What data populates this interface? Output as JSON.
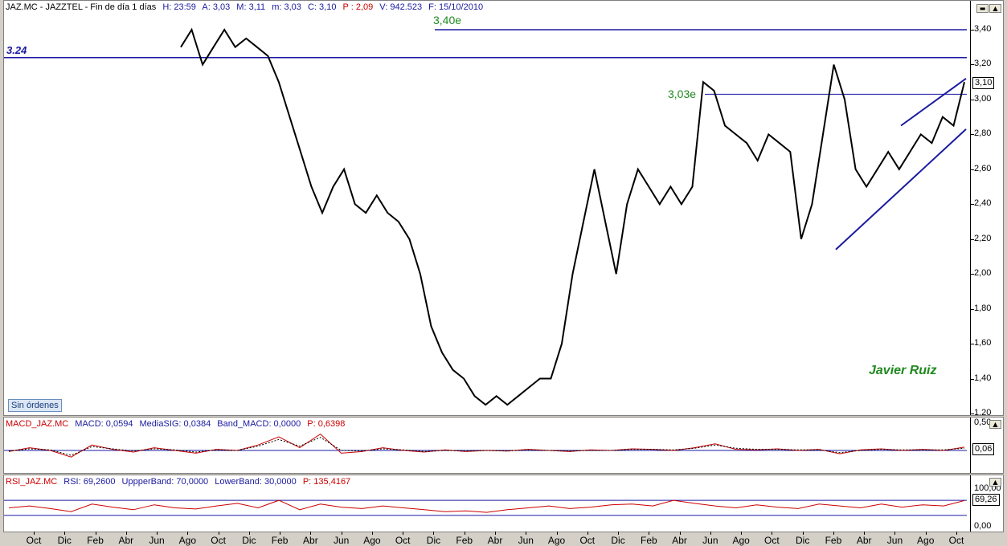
{
  "price_pane": {
    "header": {
      "symbol": "JAZ.MC - JAZZTEL - Fin de día 1 días",
      "h": "H: 23:59",
      "a": "A: 3,03",
      "m_hi": "M: 3,11",
      "m_lo": "m: 3,03",
      "c": "C: 3,10",
      "p": "P : 2,09",
      "v": "V: 942.523",
      "f": "F: 15/10/2010"
    },
    "sin_ordenes": "Sin órdenes",
    "author": "Javier Ruiz",
    "annotations": {
      "top_line": "3,40e",
      "mid_line": "3,03e",
      "left_line": "3.24"
    },
    "last_value": "3,10"
  },
  "macd_pane": {
    "header": {
      "name": "MACD_JAZ.MC",
      "macd": "MACD: 0,0594",
      "signal": "MediaSIG: 0,0384",
      "band": "Band_MACD: 0,0000",
      "p": "P: 0,6398"
    },
    "last_value": "0,06"
  },
  "rsi_pane": {
    "header": {
      "name": "RSI_JAZ.MC",
      "rsi": "RSI: 69,2600",
      "upper": "UppperBand: 70,0000",
      "lower": "LowerBand: 30,0000",
      "p": "P: 135,4167"
    },
    "last_value": "69,26"
  },
  "colors": {
    "price": "#000000",
    "trendline": "#1a1aa0",
    "macd": "#cc0000",
    "signal": "#000000",
    "rsi": "#cc0000",
    "header_blue": "#1a1aa0",
    "header_red": "#cc0000",
    "label_green": "#1f8a1f"
  },
  "chart_data": [
    {
      "type": "line",
      "title": "",
      "xlabel": "",
      "ylabel": "",
      "ylim": [
        1.2,
        3.45
      ],
      "y_ticks": [
        "3,40",
        "3,20",
        "3,00",
        "2,80",
        "2,60",
        "2,40",
        "2,20",
        "2,00",
        "1,80",
        "1,60",
        "1,40",
        "1,20"
      ],
      "x_ticks": [
        "Oct",
        "Dic",
        "Feb",
        "Abr",
        "Jun",
        "Ago",
        "Oct",
        "Dic",
        "Feb",
        "Abr",
        "Jun",
        "Ago",
        "Oct",
        "Dic",
        "Feb",
        "Abr",
        "Jun",
        "Ago",
        "Oct",
        "Dic",
        "Feb",
        "Abr",
        "Jun",
        "Ago",
        "Oct",
        "Dic",
        "Feb",
        "Abr",
        "Jun",
        "Ago",
        "Oct"
      ],
      "series": [
        {
          "values": [
            3.3,
            3.4,
            3.2,
            3.3,
            3.4,
            3.3,
            3.35,
            3.3,
            3.25,
            3.1,
            2.9,
            2.7,
            2.5,
            2.35,
            2.5,
            2.6,
            2.4,
            2.35,
            2.45,
            2.35,
            2.3,
            2.2,
            2.0,
            1.7,
            1.55,
            1.45,
            1.4,
            1.3,
            1.25,
            1.3,
            1.25,
            1.3,
            1.35,
            1.4,
            1.4,
            1.6,
            2.0,
            2.3,
            2.6,
            2.3,
            2.0,
            2.4,
            2.6,
            2.5,
            2.4,
            2.5,
            2.4,
            2.5,
            3.1,
            3.05,
            2.85,
            2.8,
            2.75,
            2.65,
            2.8,
            2.75,
            2.7,
            2.2,
            2.4,
            2.8,
            3.2,
            3.0,
            2.6,
            2.5,
            2.6,
            2.7,
            2.6,
            2.7,
            2.8,
            2.75,
            2.9,
            2.85,
            3.1
          ]
        }
      ],
      "hlines": [
        3.4,
        3.24,
        3.03
      ],
      "grid": false
    },
    {
      "type": "line",
      "title": "",
      "y_ticks": [
        "0,50",
        "0,00"
      ],
      "series": [
        {
          "name": "MACD",
          "values": [
            -0.02,
            0.05,
            0.0,
            -0.12,
            0.1,
            0.02,
            -0.03,
            0.05,
            0.0,
            -0.05,
            0.02,
            0.0,
            0.1,
            0.25,
            0.05,
            0.3,
            -0.05,
            -0.02,
            0.05,
            0.0,
            -0.03,
            0.01,
            -0.02,
            0.0,
            -0.01,
            0.02,
            0.0,
            -0.02,
            0.01,
            0.0,
            0.03,
            0.02,
            0.0,
            0.05,
            0.12,
            0.02,
            0.01,
            0.03,
            0.0,
            0.02,
            -0.06,
            0.01,
            0.03,
            0.0,
            0.02,
            0.0,
            0.06
          ]
        },
        {
          "name": "MediaSIG",
          "values": [
            -0.01,
            0.03,
            0.01,
            -0.09,
            0.07,
            0.03,
            -0.01,
            0.03,
            0.01,
            -0.03,
            0.01,
            0.0,
            0.08,
            0.2,
            0.08,
            0.24,
            0.0,
            -0.01,
            0.03,
            0.01,
            -0.02,
            0.0,
            -0.01,
            0.0,
            -0.01,
            0.01,
            0.0,
            -0.01,
            0.0,
            0.0,
            0.02,
            0.02,
            0.01,
            0.04,
            0.1,
            0.04,
            0.02,
            0.02,
            0.01,
            0.01,
            -0.04,
            0.0,
            0.02,
            0.01,
            0.01,
            0.01,
            0.04
          ]
        }
      ],
      "hlines": [
        0.0
      ]
    },
    {
      "type": "line",
      "title": "",
      "y_ticks": [
        "100,00",
        "0,00"
      ],
      "ylim": [
        0,
        100
      ],
      "series": [
        {
          "name": "RSI",
          "values": [
            50,
            55,
            48,
            40,
            60,
            52,
            45,
            58,
            50,
            47,
            55,
            62,
            50,
            70,
            45,
            60,
            52,
            48,
            55,
            50,
            45,
            40,
            42,
            38,
            45,
            50,
            55,
            48,
            52,
            58,
            60,
            55,
            70,
            62,
            55,
            50,
            58,
            52,
            48,
            60,
            55,
            50,
            60,
            52,
            58,
            55,
            69.26
          ]
        }
      ],
      "hlines": [
        70,
        30
      ]
    }
  ]
}
